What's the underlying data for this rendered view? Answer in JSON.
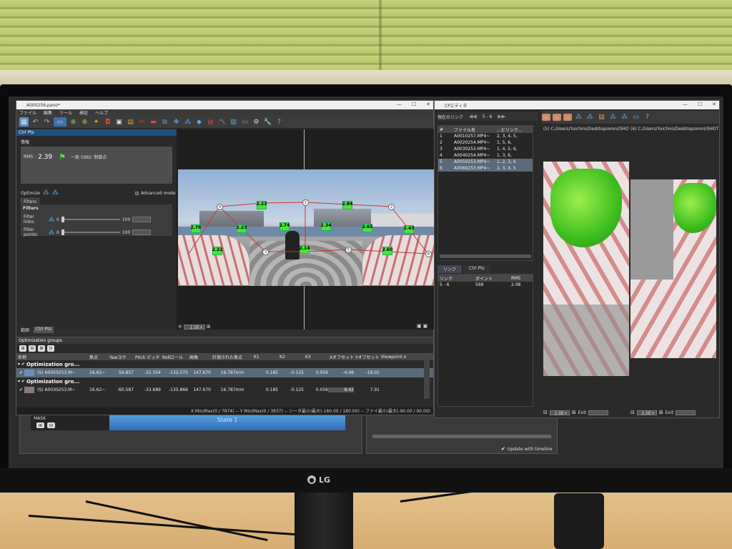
{
  "monitor": {
    "brand": "LG"
  },
  "main_window": {
    "title": "A000256.pano*",
    "menu": [
      "ファイル",
      "編集",
      "ツール",
      "検証",
      "ヘルプ"
    ],
    "panel_title": "Ctrl Pts",
    "info_label": "情報",
    "rms_label": "RMS :",
    "rms_value": "2.39",
    "points_value": "一致 5982",
    "points_suffix": "制御点",
    "optimize_label": "Optimize",
    "advanced_mode_label": "Advanced mode",
    "filters_tab": "Filters",
    "filters_header": "Filters",
    "filter_links_label": "Filter links:",
    "filter_links_min": "0",
    "filter_links_max": "100",
    "filter_points_label": "Filter points:",
    "filter_points_min": "0",
    "filter_points_max": "100",
    "bottom_tabs": [
      "範囲",
      "Ctrl Pts"
    ],
    "zoom_value": "1.0E+",
    "control_points": [
      "2.23",
      "2.84",
      "2.76",
      "2.23",
      "2.74",
      "2.34",
      "2.65",
      "2.43",
      "2.22",
      "2.14",
      "2.60"
    ],
    "nodes": [
      "4",
      "1",
      "2",
      "3",
      "5",
      "6"
    ]
  },
  "optimization": {
    "title": "Optimization groups",
    "columns": [
      "名称",
      "焦点",
      "Yawヨウ",
      "Pitch ピッチ",
      "Rollロール",
      "画角",
      "計測された焦点",
      "K1",
      "K2",
      "K3",
      "Xオフセット",
      "Yオフセット",
      "Viewpoint o"
    ],
    "groups": [
      {
        "name": "Optimization gro...",
        "row": [
          "(S) A0050253.M~",
          "16.62~",
          "56.857",
          "-32.354",
          "-132.575",
          "147.670",
          "16.787mm",
          "0.185",
          "-0.125",
          "0.056",
          "-4.08",
          "-19.01"
        ]
      },
      {
        "name": "Optimization gro...",
        "row": [
          "(S) A0030253.M~",
          "16.62~",
          "-60.587",
          "-33.689",
          "-135.866",
          "147.670",
          "16.787mm",
          "0.185",
          "-0.125",
          "0.056",
          "8.42",
          "7.91"
        ]
      }
    ],
    "status": "X Min/Max(0 / 7874)  --  Y Min/Max(0 / 3937)  --  シータ最小/最大(-180.00 / 180.00)  --  ファイ最小/最大(-90.00 / 90.00)"
  },
  "timeline": {
    "mask_label": "MASK",
    "state_label": "State 1",
    "update_label": "Update with timeline"
  },
  "cp_editor": {
    "title": "CPエディタ",
    "current_link_label": "現在のリンク",
    "current_link_value": "5 - 6",
    "path_left": "(5) C:/Users/Yuichiro/Desktop/omni/SHOT",
    "path_right": "(6) C:/Users/Yuichiro/Desktop/omni/SHOT",
    "files_columns": [
      "#",
      "ファイル名",
      "...ビリンク..."
    ],
    "files": [
      [
        "1",
        "A0010257.MP4~",
        "2, 3, 4, 5,"
      ],
      [
        "2",
        "A0020254.MP4~",
        "1, 5, 6,"
      ],
      [
        "3",
        "A0030253.MP4~",
        "1, 4, 5, 6,"
      ],
      [
        "4",
        "A0040254.MP4~",
        "1, 3, 6,"
      ],
      [
        "5",
        "A0050253.MP4~",
        "1, 2, 3, 6"
      ],
      [
        "6",
        "A0060253.MP4~",
        "2, 3, 4, 5"
      ]
    ],
    "tabs": [
      "リンク",
      "Ctrl Pts"
    ],
    "links_columns": [
      "リンク",
      "ポイント",
      "RMS"
    ],
    "links": [
      [
        "5 - 6",
        "569",
        "2.08"
      ]
    ],
    "bottom_left_zoom": "1.0E+",
    "bottom_right_zoom": "1.0E+",
    "exit_label": "Exit"
  }
}
